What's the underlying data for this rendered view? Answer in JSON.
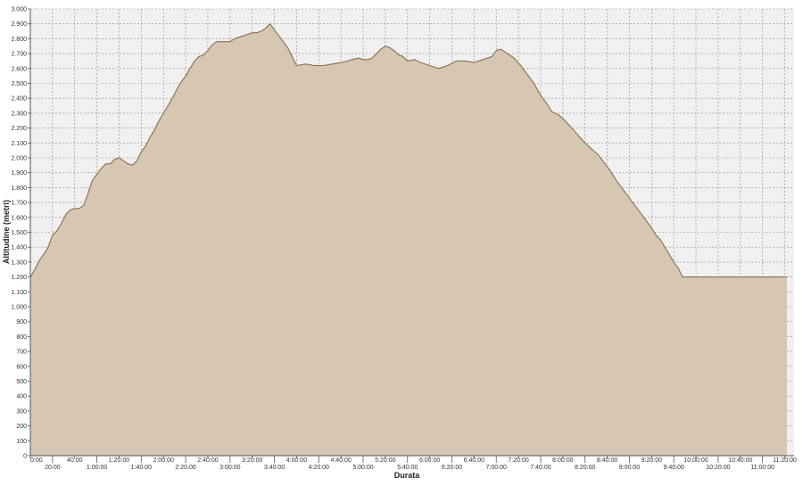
{
  "chart_data": {
    "type": "area",
    "xlabel": "Durata",
    "ylabel": "Altitudine (metri)",
    "xunit": "minutes",
    "xlim": [
      0,
      682
    ],
    "ylim": [
      0,
      3000
    ],
    "grid": true,
    "legend": "none",
    "colors": {
      "fill": "#d6c6b2",
      "line": "#8a6e4e",
      "background": "#f0f0f0",
      "grid": "#8a8a8a",
      "axis": "#555555"
    },
    "yticks": [
      {
        "value": 0,
        "label": "0"
      },
      {
        "value": 100,
        "label": "100"
      },
      {
        "value": 200,
        "label": "200"
      },
      {
        "value": 300,
        "label": "300"
      },
      {
        "value": 400,
        "label": "400"
      },
      {
        "value": 500,
        "label": "500"
      },
      {
        "value": 600,
        "label": "600"
      },
      {
        "value": 700,
        "label": "700"
      },
      {
        "value": 800,
        "label": "800"
      },
      {
        "value": 900,
        "label": "900"
      },
      {
        "value": 1000,
        "label": "1.000"
      },
      {
        "value": 1100,
        "label": "1.100"
      },
      {
        "value": 1200,
        "label": "1.200"
      },
      {
        "value": 1300,
        "label": "1.300"
      },
      {
        "value": 1400,
        "label": "1.400"
      },
      {
        "value": 1500,
        "label": "1.500"
      },
      {
        "value": 1600,
        "label": "1.600"
      },
      {
        "value": 1700,
        "label": "1.700"
      },
      {
        "value": 1800,
        "label": "1.800"
      },
      {
        "value": 1900,
        "label": "1.900"
      },
      {
        "value": 2000,
        "label": "2.000"
      },
      {
        "value": 2100,
        "label": "2.100"
      },
      {
        "value": 2200,
        "label": "2.200"
      },
      {
        "value": 2300,
        "label": "2.300"
      },
      {
        "value": 2400,
        "label": "2.400"
      },
      {
        "value": 2500,
        "label": "2.500"
      },
      {
        "value": 2600,
        "label": "2.600"
      },
      {
        "value": 2700,
        "label": "2.700"
      },
      {
        "value": 2800,
        "label": "2.800"
      },
      {
        "value": 2900,
        "label": "2.900"
      },
      {
        "value": 3000,
        "label": "3.000"
      }
    ],
    "xticks": [
      {
        "value": 0,
        "label": "0:00"
      },
      {
        "value": 20,
        "label": "20:00"
      },
      {
        "value": 40,
        "label": "40:00"
      },
      {
        "value": 60,
        "label": "1:00:00"
      },
      {
        "value": 80,
        "label": "1:20:00"
      },
      {
        "value": 100,
        "label": "1:40:00"
      },
      {
        "value": 120,
        "label": "2:00:00"
      },
      {
        "value": 140,
        "label": "2:20:00"
      },
      {
        "value": 160,
        "label": "2:40:00"
      },
      {
        "value": 180,
        "label": "3:00:00"
      },
      {
        "value": 200,
        "label": "3:20:00"
      },
      {
        "value": 220,
        "label": "3:40:00"
      },
      {
        "value": 240,
        "label": "4:00:00"
      },
      {
        "value": 260,
        "label": "4:20:00"
      },
      {
        "value": 280,
        "label": "4:40:00"
      },
      {
        "value": 300,
        "label": "5:00:00"
      },
      {
        "value": 320,
        "label": "5:20:00"
      },
      {
        "value": 340,
        "label": "5:40:00"
      },
      {
        "value": 360,
        "label": "6:00:00"
      },
      {
        "value": 380,
        "label": "6:20:00"
      },
      {
        "value": 400,
        "label": "6:40:00"
      },
      {
        "value": 420,
        "label": "7:00:00"
      },
      {
        "value": 440,
        "label": "7:20:00"
      },
      {
        "value": 460,
        "label": "7:40:00"
      },
      {
        "value": 480,
        "label": "8:00:00"
      },
      {
        "value": 500,
        "label": "8:20:00"
      },
      {
        "value": 520,
        "label": "8:40:00"
      },
      {
        "value": 540,
        "label": "9:00:00"
      },
      {
        "value": 560,
        "label": "9:20:00"
      },
      {
        "value": 580,
        "label": "9:40:00"
      },
      {
        "value": 600,
        "label": "10:00:00"
      },
      {
        "value": 620,
        "label": "10:20:00"
      },
      {
        "value": 640,
        "label": "10:40:00"
      },
      {
        "value": 660,
        "label": "11:00:00"
      },
      {
        "value": 680,
        "label": "11:20:00"
      }
    ],
    "series": [
      {
        "x": [
          0,
          4,
          8,
          12,
          16,
          20,
          24,
          28,
          32,
          36,
          40,
          44,
          48,
          52,
          56,
          60,
          64,
          68,
          72,
          76,
          80,
          84,
          88,
          92,
          96,
          100,
          104,
          108,
          112,
          116,
          120,
          124,
          128,
          132,
          136,
          140,
          144,
          148,
          152,
          156,
          160,
          164,
          168,
          172,
          176,
          180,
          184,
          188,
          192,
          196,
          200,
          204,
          208,
          212,
          216,
          220,
          224,
          228,
          232,
          236,
          240,
          248,
          256,
          264,
          272,
          280,
          286,
          290,
          296,
          300,
          304,
          308,
          312,
          316,
          320,
          324,
          328,
          332,
          336,
          340,
          346,
          352,
          360,
          368,
          376,
          384,
          392,
          400,
          408,
          416,
          420,
          424,
          430,
          436,
          442,
          448,
          454,
          460,
          466,
          470,
          476,
          482,
          488,
          494,
          500,
          506,
          512,
          516,
          520,
          524,
          528,
          532,
          536,
          540,
          544,
          548,
          552,
          556,
          560,
          564,
          568,
          572,
          576,
          580,
          584,
          588,
          592,
          596,
          600,
          604,
          608,
          612,
          616,
          620,
          624,
          628,
          632,
          636,
          640,
          644,
          648,
          652,
          656,
          660,
          664,
          668,
          672,
          676,
          680,
          682
        ],
        "y": [
          1200,
          1250,
          1310,
          1350,
          1400,
          1480,
          1510,
          1560,
          1620,
          1650,
          1660,
          1660,
          1680,
          1760,
          1850,
          1890,
          1930,
          1960,
          1960,
          1990,
          2000,
          1980,
          1960,
          1950,
          1980,
          2040,
          2080,
          2140,
          2190,
          2250,
          2300,
          2350,
          2400,
          2460,
          2510,
          2550,
          2600,
          2650,
          2680,
          2690,
          2720,
          2760,
          2780,
          2780,
          2780,
          2780,
          2800,
          2810,
          2820,
          2830,
          2840,
          2840,
          2850,
          2870,
          2900,
          2860,
          2820,
          2780,
          2740,
          2680,
          2620,
          2630,
          2620,
          2620,
          2630,
          2640,
          2650,
          2660,
          2670,
          2660,
          2660,
          2670,
          2700,
          2730,
          2750,
          2740,
          2720,
          2690,
          2680,
          2650,
          2660,
          2640,
          2620,
          2600,
          2620,
          2650,
          2650,
          2640,
          2660,
          2680,
          2720,
          2730,
          2700,
          2670,
          2620,
          2560,
          2500,
          2420,
          2360,
          2310,
          2290,
          2250,
          2200,
          2150,
          2100,
          2060,
          2020,
          1980,
          1940,
          1900,
          1850,
          1810,
          1770,
          1730,
          1690,
          1650,
          1610,
          1570,
          1530,
          1480,
          1450,
          1400,
          1350,
          1300,
          1260,
          1200,
          1200,
          1200,
          1200,
          1200,
          1200,
          1200,
          1200,
          1200,
          1200,
          1200,
          1200,
          1200,
          1200,
          1200,
          1200,
          1200,
          1200,
          1200,
          1200,
          1200,
          1200,
          1200,
          1200,
          1200
        ]
      }
    ]
  }
}
